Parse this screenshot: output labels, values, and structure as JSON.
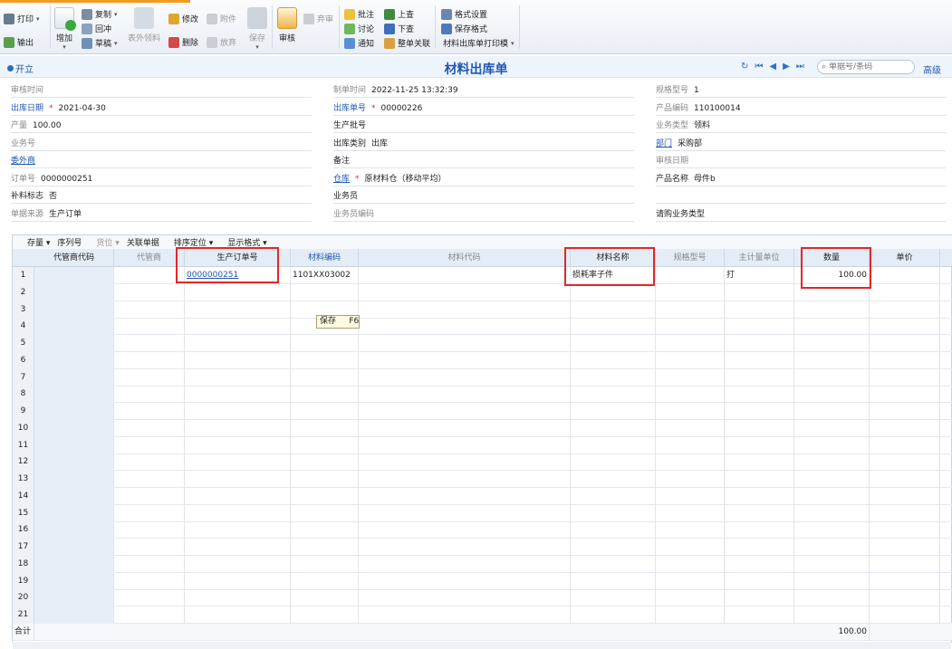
{
  "toolbar": {
    "print": "打印",
    "output": "输出",
    "add": "增加",
    "copy": "复制",
    "redflush": "回冲",
    "draft": "草稿",
    "external_pick": "表外领料",
    "modify": "修改",
    "delete": "删除",
    "attach": "附件",
    "abandon": "放弃",
    "save": "保存",
    "audit": "审核",
    "unaudit": "弃审",
    "annotate": "批注",
    "discuss": "讨论",
    "notify": "通知",
    "prev_doc": "上查",
    "next_doc": "下查",
    "whole_link": "整单关联",
    "format_setting": "格式设置",
    "save_format": "保存格式",
    "print_template": "材料出库单打印模"
  },
  "header": {
    "status": "开立",
    "title": "材料出库单",
    "search_placeholder": "单据号/条码",
    "advanced": "高级"
  },
  "form": {
    "col1": [
      {
        "label": "审核时间",
        "value": "",
        "style": "gray"
      },
      {
        "label": "出库日期",
        "value": "2021-04-30",
        "style": "req",
        "star": "*"
      },
      {
        "label": "产量",
        "value": "100.00",
        "style": "gray"
      },
      {
        "label": "业务号",
        "value": "",
        "style": "gray"
      },
      {
        "label": "委外商",
        "value": "",
        "style": "link"
      },
      {
        "label": "订单号",
        "value": "0000000251",
        "style": "gray"
      },
      {
        "label": "补料标志",
        "value": "否",
        "style": "dark"
      },
      {
        "label": "单据来源",
        "value": "生产订单",
        "style": "gray"
      }
    ],
    "col2": [
      {
        "label": "制单时间",
        "value": "2022-11-25 13:32:39",
        "style": "gray"
      },
      {
        "label": "出库单号",
        "value": "00000226",
        "style": "req",
        "star": "*"
      },
      {
        "label": "生产批号",
        "value": "",
        "style": "dark"
      },
      {
        "label": "出库类别",
        "value": "出库",
        "style": "dark"
      },
      {
        "label": "备注",
        "value": "",
        "style": "dark"
      },
      {
        "label": "仓库",
        "value": "原材料仓（移动平均）",
        "style": "link",
        "star": "*"
      },
      {
        "label": "业务员",
        "value": "",
        "style": "dark"
      },
      {
        "label": "业务员编码",
        "value": "",
        "style": "gray"
      }
    ],
    "col3": [
      {
        "label": "规格型号",
        "value": "1",
        "style": "gray"
      },
      {
        "label": "产品编码",
        "value": "110100014",
        "style": "gray"
      },
      {
        "label": "业务类型",
        "value": "领料",
        "style": "gray"
      },
      {
        "label": "部门",
        "value": "采购部",
        "style": "link"
      },
      {
        "label": "审核日期",
        "value": "",
        "style": "gray"
      },
      {
        "label": "产品名称",
        "value": "母件b",
        "style": "dark"
      },
      {
        "label": "",
        "value": "",
        "style": "gray"
      },
      {
        "label": "请购业务类型",
        "value": "",
        "style": "dark"
      }
    ]
  },
  "grid_toolbar": {
    "stock": "存量",
    "serial": "序列号",
    "location": "货位",
    "linked_doc": "关联单据",
    "sort_locate": "排序定位",
    "display_format": "显示格式"
  },
  "grid": {
    "columns": [
      "代管商代码",
      "代管商",
      "生产订单号",
      "材料编码",
      "材料代码",
      "材料名称",
      "规格型号",
      "主计量单位",
      "数量",
      "单价"
    ],
    "rows": [
      {
        "no": "1",
        "cells": [
          "",
          "",
          "0000000251",
          "1101XX03002",
          "",
          "损耗率子件",
          "",
          "打",
          "100.00",
          ""
        ]
      },
      {
        "no": "2"
      },
      {
        "no": "3"
      },
      {
        "no": "4"
      },
      {
        "no": "5"
      },
      {
        "no": "6"
      },
      {
        "no": "7"
      },
      {
        "no": "8"
      },
      {
        "no": "9"
      },
      {
        "no": "10"
      },
      {
        "no": "11"
      },
      {
        "no": "12"
      },
      {
        "no": "13"
      },
      {
        "no": "14"
      },
      {
        "no": "15"
      },
      {
        "no": "16"
      },
      {
        "no": "17"
      },
      {
        "no": "18"
      },
      {
        "no": "19"
      },
      {
        "no": "20"
      },
      {
        "no": "21"
      }
    ],
    "total_label": "合计",
    "total_qty": "100.00",
    "tooltip_text": "保存",
    "tooltip_key": "F6"
  }
}
